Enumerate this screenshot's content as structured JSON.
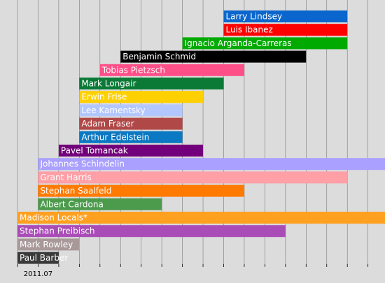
{
  "chart_data": {
    "type": "bar",
    "orientation": "horizontal-timeline",
    "x_unit": "months",
    "x_tick_labels": [
      {
        "month": 1,
        "label": "2011.07"
      }
    ],
    "x_axis_ticks_months": [
      0,
      1,
      2,
      3,
      4,
      5,
      6,
      7,
      8,
      9,
      10,
      11,
      12,
      13,
      14,
      15,
      16,
      17,
      18
    ],
    "grid": true,
    "bars": [
      {
        "name": "Larry Lindsey",
        "start": 10.0,
        "end": 16.0,
        "color": "#0a66cc",
        "text_color": "#ffffff"
      },
      {
        "name": "Luis Ibanez",
        "start": 10.0,
        "end": 16.0,
        "color": "#ff0000",
        "text_color": "#ffffff"
      },
      {
        "name": "Ignacio Arganda-Carreras",
        "start": 8.0,
        "end": 16.0,
        "color": "#00aa00",
        "text_color": "#ffffff"
      },
      {
        "name": "Benjamin Schmid",
        "start": 5.0,
        "end": 14.0,
        "color": "#000000",
        "text_color": "#ffffff"
      },
      {
        "name": "Tobias Pietzsch",
        "start": 4.0,
        "end": 11.0,
        "color": "#ff4f88",
        "text_color": "#ffffff"
      },
      {
        "name": "Mark Longair",
        "start": 3.0,
        "end": 10.0,
        "color": "#0a7a36",
        "text_color": "#ffffff"
      },
      {
        "name": "Erwin Frise",
        "start": 3.0,
        "end": 9.0,
        "color": "#ffd000",
        "text_color": "#ffffff"
      },
      {
        "name": "Lee Kamentsky",
        "start": 3.0,
        "end": 8.0,
        "color": "#b3c7ff",
        "text_color": "#ffffff"
      },
      {
        "name": "Adam Fraser",
        "start": 3.0,
        "end": 8.0,
        "color": "#b04848",
        "text_color": "#ffffff"
      },
      {
        "name": "Arthur Edelstein",
        "start": 3.0,
        "end": 8.0,
        "color": "#0a78c2",
        "text_color": "#ffffff"
      },
      {
        "name": "Pavel Tomancak",
        "start": 2.0,
        "end": 9.0,
        "color": "#72007a",
        "text_color": "#ffffff"
      },
      {
        "name": "Johannes Schindelin",
        "start": 1.0,
        "end": 18.0,
        "color": "#a9a0ff",
        "text_color": "#ffffff"
      },
      {
        "name": "Grant Harris",
        "start": 1.0,
        "end": 16.0,
        "color": "#ff9fa6",
        "text_color": "#ffffff"
      },
      {
        "name": "Stephan Saalfeld",
        "start": 1.0,
        "end": 11.0,
        "color": "#ff7a00",
        "text_color": "#ffffff"
      },
      {
        "name": "Albert Cardona",
        "start": 1.0,
        "end": 7.0,
        "color": "#4c9a4c",
        "text_color": "#ffffff"
      },
      {
        "name": "Madison Locals*",
        "start": 0.0,
        "end": 18.0,
        "color": "#ffa020",
        "text_color": "#ffffff"
      },
      {
        "name": "Stephan Preibisch",
        "start": 0.0,
        "end": 13.0,
        "color": "#aa4cb8",
        "text_color": "#ffffff"
      },
      {
        "name": "Mark Rowley",
        "start": 0.0,
        "end": 3.0,
        "color": "#a89898",
        "text_color": "#ffffff"
      },
      {
        "name": "Paul Barber",
        "start": 0.0,
        "end": 2.0,
        "color": "#3a3a3a",
        "text_color": "#ffffff"
      }
    ],
    "colors": {
      "background": "#dcdcdc",
      "grid": "#000000"
    }
  }
}
